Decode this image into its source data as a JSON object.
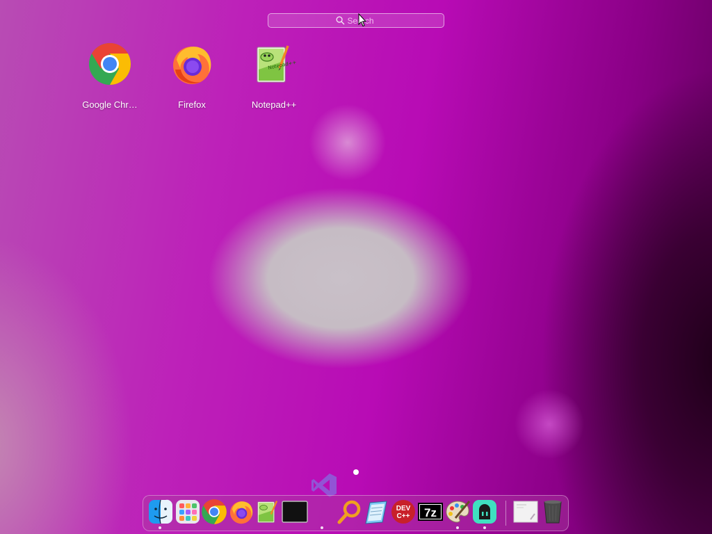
{
  "search": {
    "placeholder": "Search"
  },
  "apps": [
    {
      "label": "Google Chr…",
      "icon": "chrome-icon"
    },
    {
      "label": "Firefox",
      "icon": "firefox-icon"
    },
    {
      "label": "Notepad++",
      "icon": "notepadpp-icon"
    }
  ],
  "dock": {
    "items": [
      {
        "name": "finder",
        "icon": "finder-icon",
        "running": true
      },
      {
        "name": "launchpad",
        "icon": "launchpad-icon",
        "running": false
      },
      {
        "name": "chrome",
        "icon": "chrome-icon",
        "running": false
      },
      {
        "name": "firefox",
        "icon": "firefox-icon",
        "running": false
      },
      {
        "name": "notepadpp",
        "icon": "notepadpp-icon",
        "running": false
      },
      {
        "name": "terminal",
        "icon": "terminal-icon",
        "running": false
      },
      {
        "name": "vscode",
        "icon": "vscode-icon",
        "running": true
      },
      {
        "name": "search-tool",
        "icon": "magnifier-icon",
        "running": false
      },
      {
        "name": "notepad",
        "icon": "notepad-icon",
        "running": false
      },
      {
        "name": "dev-cpp",
        "icon": "devcpp-icon",
        "label": "DEV C++",
        "running": false
      },
      {
        "name": "7zip",
        "icon": "7zip-icon",
        "label": "7z",
        "running": false
      },
      {
        "name": "paint",
        "icon": "paint-icon",
        "running": true
      },
      {
        "name": "terminal-bot",
        "icon": "bot-icon",
        "running": true
      },
      {
        "name": "document",
        "icon": "document-icon",
        "running": false
      },
      {
        "name": "trash",
        "icon": "trash-icon",
        "running": false
      }
    ]
  },
  "colors": {
    "accent": "#bb10b8",
    "dock_border": "#ffffff"
  }
}
